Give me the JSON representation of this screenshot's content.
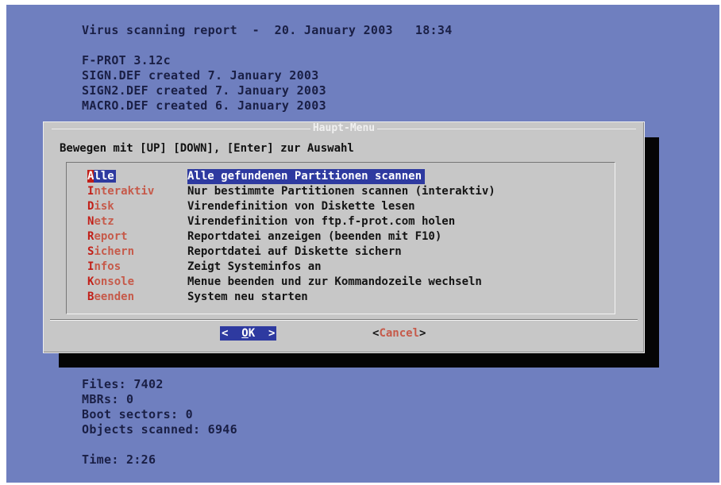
{
  "header": {
    "report_line": "Virus scanning report  -  20. January 2003   18:34",
    "version": "F-PROT 3.12c",
    "defs": [
      "SIGN.DEF created 7. January 2003",
      "SIGN2.DEF created 7. January 2003",
      "MACRO.DEF created 6. January 2003"
    ]
  },
  "dialog": {
    "title": "Haupt-Menu",
    "instruction": "Bewegen mit [UP] [DOWN], [Enter] zur Auswahl",
    "items": [
      {
        "hotkey": "A",
        "rest": "lle",
        "desc": "Alle gefundenen Partitionen scannen",
        "selected": true
      },
      {
        "hotkey": "I",
        "rest": "nteraktiv",
        "desc": "Nur bestimmte Partitionen scannen (interaktiv)",
        "selected": false
      },
      {
        "hotkey": "D",
        "rest": "isk",
        "desc": "Virendefinition von Diskette lesen",
        "selected": false
      },
      {
        "hotkey": "N",
        "rest": "etz",
        "desc": "Virendefinition von ftp.f-prot.com holen",
        "selected": false
      },
      {
        "hotkey": "R",
        "rest": "eport",
        "desc": "Reportdatei anzeigen (beenden mit F10)",
        "selected": false
      },
      {
        "hotkey": "S",
        "rest": "ichern",
        "desc": "Reportdatei auf Diskette sichern",
        "selected": false
      },
      {
        "hotkey": "I",
        "rest": "nfos",
        "desc": "Zeigt Systeminfos an",
        "selected": false
      },
      {
        "hotkey": "K",
        "rest": "onsole",
        "desc": "Menue beenden und zur Kommandozeile wechseln",
        "selected": false
      },
      {
        "hotkey": "B",
        "rest": "eenden",
        "desc": "System neu starten",
        "selected": false
      }
    ],
    "ok": {
      "left": "<  ",
      "hotkey": "O",
      "rest": "K",
      "right": "  >"
    },
    "cancel": {
      "left": "<",
      "hotkey": "C",
      "rest": "ancel",
      "right": ">"
    }
  },
  "stats": [
    {
      "label": "Files:",
      "value": "7402"
    },
    {
      "label": "MBRs:",
      "value": "0"
    },
    {
      "label": "Boot sectors:",
      "value": "0"
    },
    {
      "label": "Objects scanned:",
      "value": "6946"
    }
  ],
  "time": {
    "label": "Time:",
    "value": "2:26"
  },
  "colors": {
    "screen_bg": "#6f7fbf",
    "dialog_bg": "#c7c7c7",
    "selection": "#2e3aa0",
    "hotkey": "#c21f18"
  }
}
